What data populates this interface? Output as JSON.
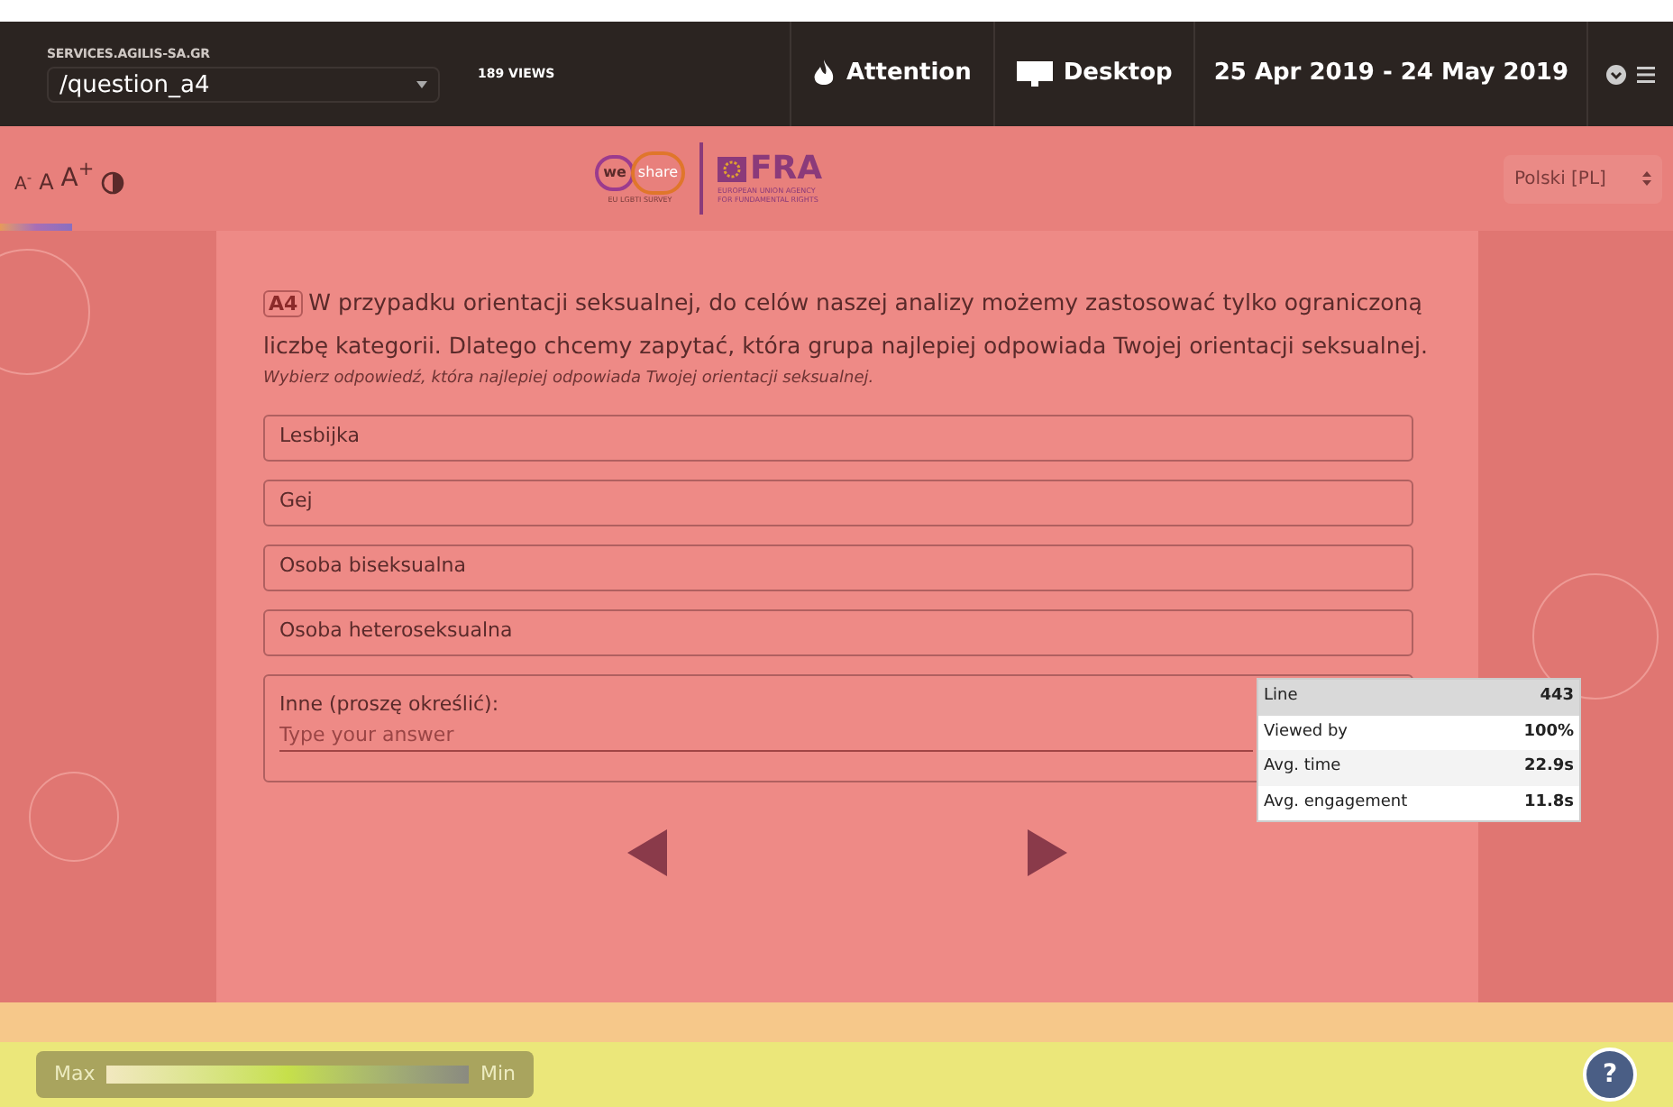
{
  "topbar": {
    "site": "SERVICES.AGILIS-SA.GR",
    "page": "/question_a4",
    "views": "189 VIEWS",
    "mode": "Attention",
    "device": "Desktop",
    "date_range": "25 Apr 2019 - 24 May 2019"
  },
  "survey_header": {
    "font_controls": [
      "A$^{-}$",
      "A",
      "A$^{+}$"
    ],
    "logo_we": "we",
    "logo_share": "share",
    "logo_sub": "EU LGBTI SURVEY",
    "fra": "FRA",
    "fra_sub": [
      "EUROPEAN UNION AGENCY",
      "FOR FUNDAMENTAL RIGHTS"
    ],
    "language": "Polski [PL]"
  },
  "question": {
    "code": "A4",
    "text": "W przypadku orientacji seksualnej, do celów naszej analizy możemy zastosować tylko ograniczoną liczbę kategorii. Dlatego chcemy zapytać, która grupa najlepiej odpowiada Twojej orientacji seksualnej.",
    "hint": "Wybierz odpowiedź, która najlepiej odpowiada Twojej orientacji seksualnej.",
    "options": [
      {
        "kind": "choice",
        "label": "Lesbijka"
      },
      {
        "kind": "choice",
        "label": "Gej"
      },
      {
        "kind": "choice",
        "label": "Osoba biseksualna"
      },
      {
        "kind": "choice",
        "label": "Osoba heteroseksualna"
      },
      {
        "kind": "other",
        "label": "Inne (proszę określić):",
        "placeholder": "Type your answer"
      }
    ]
  },
  "tooltip": [
    {
      "label": "Line",
      "value": "443"
    },
    {
      "label": "Viewed by",
      "value": "100%"
    },
    {
      "label": "Avg. time",
      "value": "22.9s"
    },
    {
      "label": "Avg. engagement",
      "value": "11.8s"
    }
  ],
  "legend": {
    "max": "Max",
    "min": "Min"
  },
  "help": "?"
}
